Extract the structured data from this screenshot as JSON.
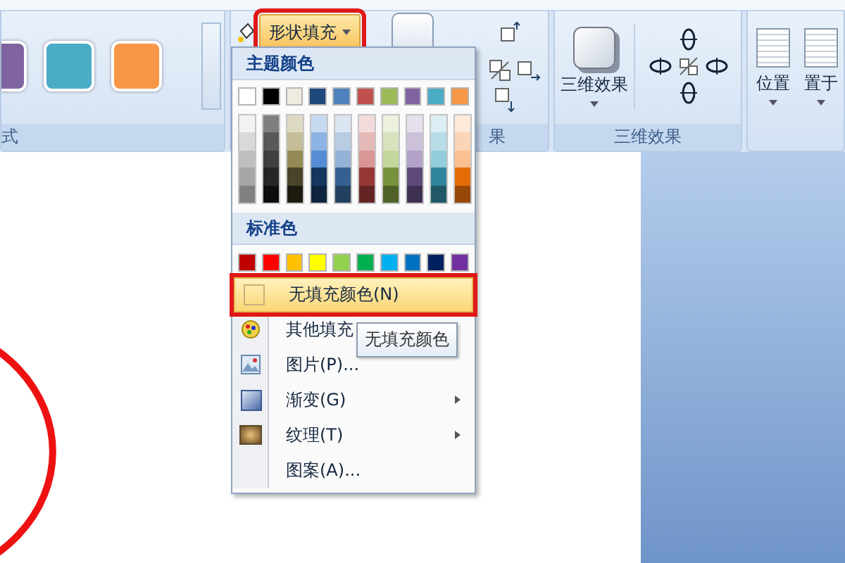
{
  "ribbon": {
    "style_group": {
      "label": "式",
      "swatches": [
        {
          "color": "#8064a2"
        },
        {
          "color": "#4bacc6"
        },
        {
          "color": "#f79646"
        }
      ]
    },
    "fill_button": {
      "label": "形状填充",
      "marked": true
    },
    "effects_group": {
      "label": "果"
    },
    "three_d_group": {
      "button": "三维效果",
      "label": "三维效果"
    },
    "arrange_group": {
      "buttons": [
        "位置",
        "置于"
      ]
    }
  },
  "fill_menu": {
    "theme_header": "主题颜色",
    "theme_colors": [
      {
        "color": "#ffffff",
        "shades": [
          {
            "color": "#f2f2f2"
          },
          {
            "color": "#d9d9d9"
          },
          {
            "color": "#bfbfbf"
          },
          {
            "color": "#a6a6a6"
          },
          {
            "color": "#808080"
          }
        ]
      },
      {
        "color": "#000000",
        "shades": [
          {
            "color": "#7f7f7f"
          },
          {
            "color": "#595959"
          },
          {
            "color": "#404040"
          },
          {
            "color": "#262626"
          },
          {
            "color": "#0d0d0d"
          }
        ]
      },
      {
        "color": "#eeece1",
        "shades": [
          {
            "color": "#ddd9c3"
          },
          {
            "color": "#c4bd97"
          },
          {
            "color": "#948a54"
          },
          {
            "color": "#4a452a"
          },
          {
            "color": "#1d1b10"
          }
        ]
      },
      {
        "color": "#1f497d",
        "shades": [
          {
            "color": "#c6d9f0"
          },
          {
            "color": "#8db3e2"
          },
          {
            "color": "#548dd4"
          },
          {
            "color": "#17365d"
          },
          {
            "color": "#0f243e"
          }
        ]
      },
      {
        "color": "#4f81bd",
        "shades": [
          {
            "color": "#dbe5f1"
          },
          {
            "color": "#b8cce4"
          },
          {
            "color": "#95b3d7"
          },
          {
            "color": "#366092"
          },
          {
            "color": "#244061"
          }
        ]
      },
      {
        "color": "#c0504d",
        "shades": [
          {
            "color": "#f2dcdb"
          },
          {
            "color": "#e5b9b7"
          },
          {
            "color": "#d99694"
          },
          {
            "color": "#953734"
          },
          {
            "color": "#632423"
          }
        ]
      },
      {
        "color": "#9bbb59",
        "shades": [
          {
            "color": "#ebf1dd"
          },
          {
            "color": "#d7e3bc"
          },
          {
            "color": "#c3d69b"
          },
          {
            "color": "#76923c"
          },
          {
            "color": "#4f6128"
          }
        ]
      },
      {
        "color": "#8064a2",
        "shades": [
          {
            "color": "#e5e0ec"
          },
          {
            "color": "#ccc1d9"
          },
          {
            "color": "#b2a2c7"
          },
          {
            "color": "#5f497a"
          },
          {
            "color": "#3f3151"
          }
        ]
      },
      {
        "color": "#4bacc6",
        "shades": [
          {
            "color": "#dbeef3"
          },
          {
            "color": "#b7dde8"
          },
          {
            "color": "#92cddc"
          },
          {
            "color": "#31859b"
          },
          {
            "color": "#205867"
          }
        ]
      },
      {
        "color": "#f79646",
        "shades": [
          {
            "color": "#fdeada"
          },
          {
            "color": "#fbd5b5"
          },
          {
            "color": "#fac08f"
          },
          {
            "color": "#e36c09"
          },
          {
            "color": "#974806"
          }
        ]
      }
    ],
    "standard_header": "标准色",
    "standard_colors": [
      {
        "color": "#c00000"
      },
      {
        "color": "#ff0000"
      },
      {
        "color": "#ffc000"
      },
      {
        "color": "#ffff00"
      },
      {
        "color": "#92d050"
      },
      {
        "color": "#00b050"
      },
      {
        "color": "#00b0f0"
      },
      {
        "color": "#0070c0"
      },
      {
        "color": "#002060"
      },
      {
        "color": "#7030a0"
      }
    ],
    "items": [
      {
        "kind": "no-fill",
        "label": "无填充颜色(N)",
        "selected": true,
        "marked": true,
        "submenu": false
      },
      {
        "kind": "more-colors",
        "label": "其他填充",
        "selected": false,
        "marked": false,
        "submenu": false
      },
      {
        "kind": "picture",
        "label": "图片(P)...",
        "selected": false,
        "marked": false,
        "submenu": false
      },
      {
        "kind": "gradient",
        "label": "渐变(G)",
        "selected": false,
        "marked": false,
        "submenu": true
      },
      {
        "kind": "texture",
        "label": "纹理(T)",
        "selected": false,
        "marked": false,
        "submenu": true
      },
      {
        "kind": "pattern",
        "label": "图案(A)...",
        "selected": false,
        "marked": false,
        "submenu": false
      }
    ]
  },
  "tooltip": "无填充颜色"
}
